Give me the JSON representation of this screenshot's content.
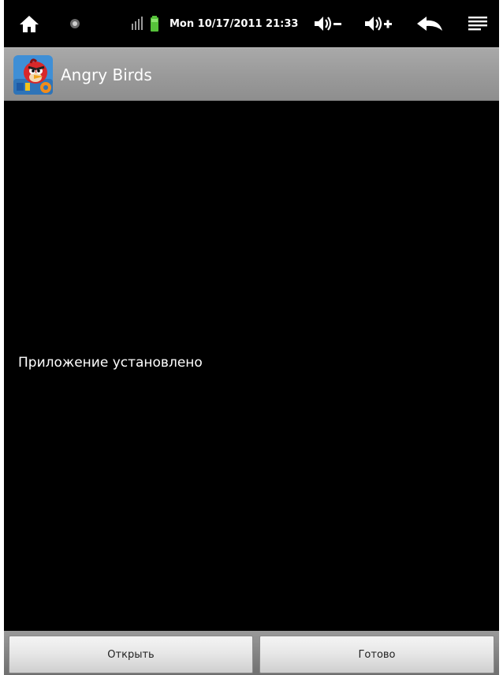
{
  "status_bar": {
    "clock": "Mon 10/17/2011 21:33",
    "icons": [
      "home-icon",
      "notification-dot-icon",
      "signal-icon",
      "battery-icon",
      "volume-down-icon",
      "volume-up-icon",
      "back-icon",
      "menu-icon"
    ],
    "battery_color": "#56c23a"
  },
  "title_bar": {
    "app_title": "Angry Birds",
    "app_icon": "angry-birds-rio-app-icon"
  },
  "content": {
    "message": "Приложение установлено"
  },
  "buttons": {
    "open_label": "Открыть",
    "done_label": "Готово"
  }
}
